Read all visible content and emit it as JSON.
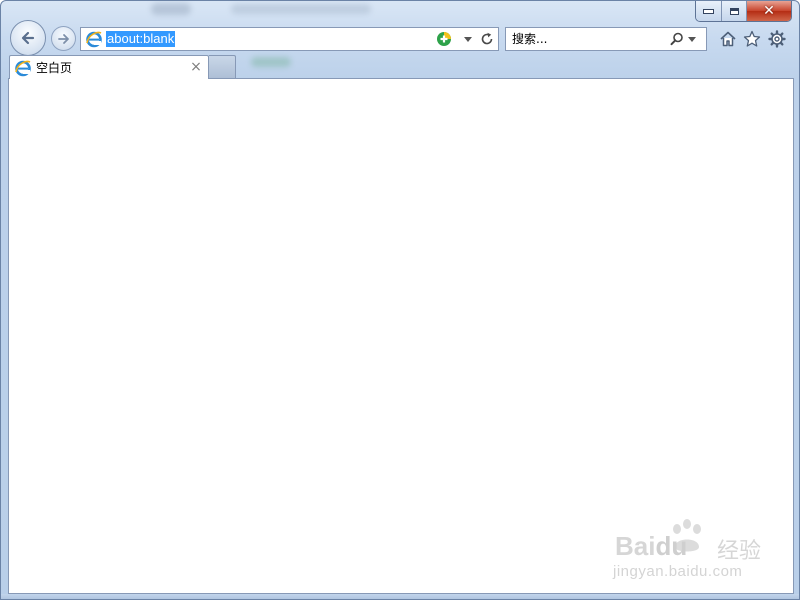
{
  "window": {
    "caption_buttons": {
      "minimize_icon": "minimize-icon",
      "maximize_icon": "restore-icon",
      "close_icon": "close-icon",
      "close_glyph": "✕"
    }
  },
  "toolbar": {
    "address": {
      "value": "about:blank",
      "page_icon": "ie-page-icon",
      "addon_icon": "addon-plus-icon",
      "dropdown_icon": "chevron-down-icon",
      "refresh_icon": "refresh-icon"
    },
    "search": {
      "placeholder": "搜索...",
      "icon": "search-icon",
      "dropdown_icon": "chevron-down-icon"
    },
    "right_icons": [
      "home-icon",
      "favorites-star-icon",
      "tools-gear-icon"
    ]
  },
  "tabs": [
    {
      "label": "空白页",
      "active": true,
      "close_glyph": "×"
    }
  ],
  "watermark": {
    "logo_text": "Bai",
    "logo_text_2": "du",
    "brand_suffix": "经验",
    "url": "jingyan.baidu.com"
  },
  "colors": {
    "frame": "#c7d9ef",
    "selection": "#3399ff",
    "close_button": "#c7432b",
    "content_bg": "#ffffff"
  }
}
